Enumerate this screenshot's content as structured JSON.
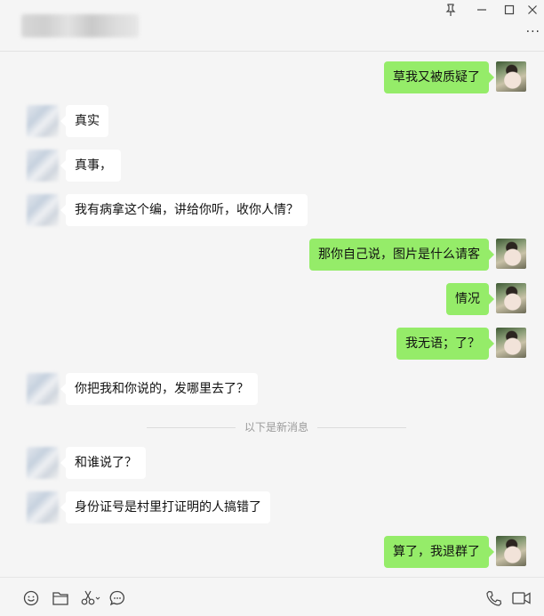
{
  "window": {
    "pin_glyph": "📌",
    "minimize_glyph": "—",
    "maximize_glyph": "☐",
    "close_glyph": "✕",
    "more_glyph": "···"
  },
  "messages": [
    {
      "dir": "out",
      "text": "草我又被质疑了"
    },
    {
      "dir": "in",
      "text": "真实"
    },
    {
      "dir": "in",
      "text": "真事，"
    },
    {
      "dir": "in",
      "text": "我有病拿这个编，讲给你听，收你人情？"
    },
    {
      "dir": "out",
      "text": "那你自己说，图片是什么请客"
    },
    {
      "dir": "out",
      "text": "情况"
    },
    {
      "dir": "out",
      "text": "我无语；了？"
    },
    {
      "dir": "in",
      "text": "你把我和你说的，发哪里去了？"
    },
    {
      "dir": "in",
      "text": "和谁说了？"
    },
    {
      "dir": "in",
      "text": "身份证号是村里打证明的人搞错了"
    },
    {
      "dir": "out",
      "text": "算了，我退群了"
    }
  ],
  "divider_text": "以下是新消息",
  "toolbar": {
    "icons": [
      "emoji-icon",
      "folder-icon",
      "scissors-icon",
      "chat-icon",
      "phone-icon",
      "video-icon"
    ]
  },
  "colors": {
    "out_bubble": "#95ec69",
    "in_bubble": "#ffffff",
    "background": "#f5f5f5"
  }
}
